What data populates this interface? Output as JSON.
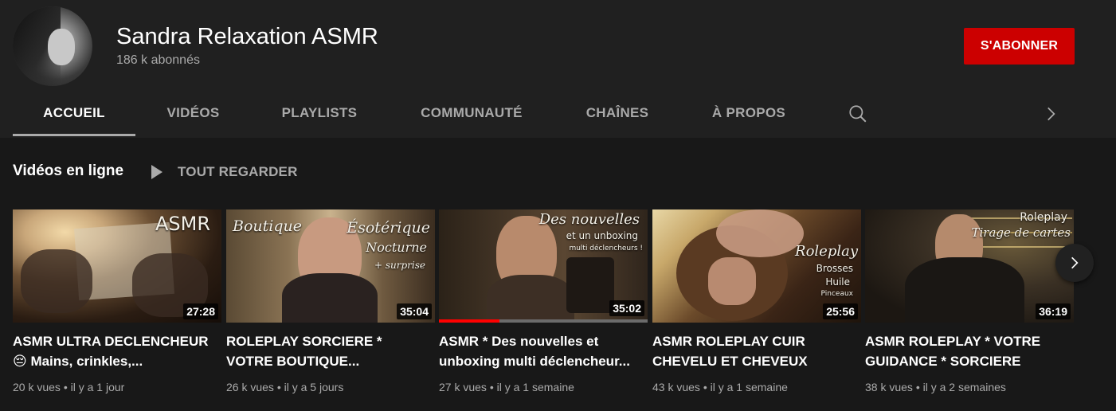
{
  "channel": {
    "name": "Sandra Relaxation ASMR",
    "subscribers": "186 k abonnés",
    "subscribe_label": "S'ABONNER"
  },
  "tabs": [
    {
      "label": "ACCUEIL",
      "active": true
    },
    {
      "label": "VIDÉOS",
      "active": false
    },
    {
      "label": "PLAYLISTS",
      "active": false
    },
    {
      "label": "COMMUNAUTÉ",
      "active": false
    },
    {
      "label": "CHAÎNES",
      "active": false
    },
    {
      "label": "À PROPOS",
      "active": false
    }
  ],
  "shelf": {
    "title": "Vidéos en ligne",
    "play_all_label": "TOUT REGARDER"
  },
  "videos": [
    {
      "title": "ASMR ULTRA DECLENCHEUR 😔 Mains, crinkles,...",
      "duration": "27:28",
      "views": "20 k vues",
      "age": "il y a 1 jour",
      "thumb_texts": [
        "ASMR"
      ]
    },
    {
      "title": "ROLEPLAY SORCIERE * VOTRE BOUTIQUE...",
      "duration": "35:04",
      "views": "26 k vues",
      "age": "il y a 5 jours",
      "thumb_texts": [
        "Boutique",
        "Ésotérique",
        "Nocturne",
        "+ surprise"
      ]
    },
    {
      "title": "ASMR * Des nouvelles et unboxing multi déclencheur...",
      "duration": "35:02",
      "views": "27 k vues",
      "age": "il y a 1 semaine",
      "thumb_texts": [
        "Des nouvelles",
        "et un unboxing",
        "multi déclencheurs !"
      ],
      "watched_progress": 0.29
    },
    {
      "title": "ASMR ROLEPLAY CUIR CHEVELU ET CHEVEUX",
      "duration": "25:56",
      "views": "43 k vues",
      "age": "il y a 1 semaine",
      "thumb_texts": [
        "Roleplay",
        "Brosses",
        "Huile",
        "Pinceaux"
      ]
    },
    {
      "title": "ASMR ROLEPLAY * VOTRE GUIDANCE * SORCIERE",
      "duration": "36:19",
      "views": "38 k vues",
      "age": "il y a 2 semaines",
      "thumb_texts": [
        "Roleplay",
        "Tirage de cartes"
      ]
    }
  ],
  "colors": {
    "background": "#181818",
    "header": "#202020",
    "subscribe": "#cc0000",
    "progress": "#ff0000"
  }
}
